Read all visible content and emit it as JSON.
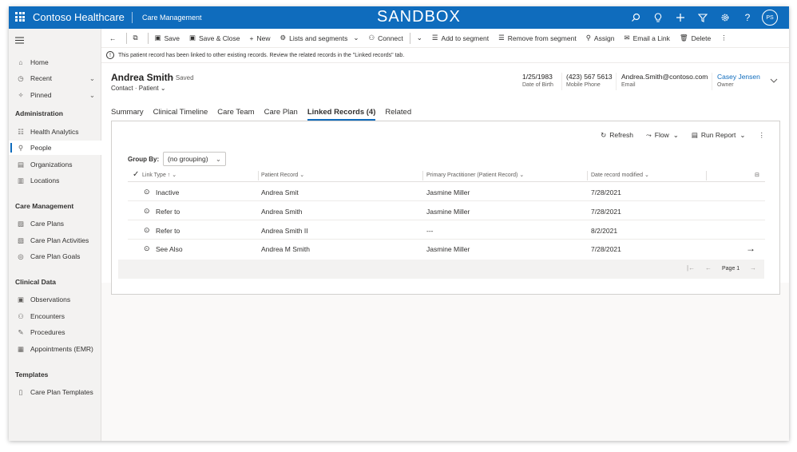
{
  "topbar": {
    "app_name": "Contoso Healthcare",
    "area": "Care Management",
    "environment": "SANDBOX",
    "icons": [
      "search-icon",
      "lightbulb-icon",
      "plus-icon",
      "filter-icon",
      "gear-icon",
      "help-icon"
    ],
    "avatar_initials": "PS"
  },
  "sidebar": {
    "top_items": [
      {
        "label": "Home",
        "icon": "home-icon"
      },
      {
        "label": "Recent",
        "icon": "clock-icon",
        "expandable": true
      },
      {
        "label": "Pinned",
        "icon": "pin-icon",
        "expandable": true
      }
    ],
    "groups": [
      {
        "title": "Administration",
        "items": [
          {
            "label": "Health Analytics",
            "icon": "analytics-icon"
          },
          {
            "label": "People",
            "icon": "person-icon",
            "active": true
          },
          {
            "label": "Organizations",
            "icon": "building-icon"
          },
          {
            "label": "Locations",
            "icon": "location-icon"
          }
        ]
      },
      {
        "title": "Care Management",
        "items": [
          {
            "label": "Care Plans",
            "icon": "care-plan-icon"
          },
          {
            "label": "Care Plan Activities",
            "icon": "activities-icon"
          },
          {
            "label": "Care Plan Goals",
            "icon": "goal-icon"
          }
        ]
      },
      {
        "title": "Clinical Data",
        "items": [
          {
            "label": "Observations",
            "icon": "observations-icon"
          },
          {
            "label": "Encounters",
            "icon": "encounters-icon"
          },
          {
            "label": "Procedures",
            "icon": "procedures-icon"
          },
          {
            "label": "Appointments (EMR)",
            "icon": "calendar-icon"
          }
        ]
      },
      {
        "title": "Templates",
        "items": [
          {
            "label": "Care Plan Templates",
            "icon": "template-icon"
          }
        ]
      }
    ]
  },
  "commandbar": {
    "save": "Save",
    "save_close": "Save & Close",
    "new": "New",
    "lists_segments": "Lists and segments",
    "connect": "Connect",
    "add_segment": "Add to segment",
    "remove_segment": "Remove from segment",
    "assign": "Assign",
    "email_link": "Email a Link",
    "delete": "Delete"
  },
  "notice": {
    "text": "This patient record has been linked to other existing records. Review the related records in the \"Linked records\" tab."
  },
  "record": {
    "name": "Andrea Smith",
    "status": "- Saved",
    "entity": "Contact",
    "form": "Patient",
    "fields": [
      {
        "value": "1/25/1983",
        "label": "Date of Birth"
      },
      {
        "value": "(423) 567 5613",
        "label": "Mobile Phone"
      },
      {
        "value": "Andrea.Smith@contoso.com",
        "label": "Email"
      },
      {
        "value": "Casey Jensen",
        "label": "Owner"
      }
    ]
  },
  "tabs": [
    "Summary",
    "Clinical Timeline",
    "Care Team",
    "Care Plan",
    "Linked Records (4)",
    "Related"
  ],
  "active_tab": "Linked Records (4)",
  "grid": {
    "commands": {
      "refresh": "Refresh",
      "flow": "Flow",
      "run_report": "Run Report"
    },
    "group_by_label": "Group By:",
    "group_by_value": "(no grouping)",
    "columns": [
      "Link Type",
      "Patient Record",
      "Primary Practitioner (Patient Record)",
      "Date record modified"
    ],
    "rows": [
      {
        "link_type": "Inactive",
        "patient": "Andrea Smit",
        "practitioner": "Jasmine Miller",
        "date": "7/28/2021"
      },
      {
        "link_type": "Refer to",
        "patient": "Andrea Smith",
        "practitioner": "Jasmine Miller",
        "date": "7/28/2021"
      },
      {
        "link_type": "Refer to",
        "patient": "Andrea Smith II",
        "practitioner": "---",
        "date": "8/2/2021"
      },
      {
        "link_type": "See Also",
        "patient": "Andrea M Smith",
        "practitioner": "Jasmine Miller",
        "date": "7/28/2021"
      }
    ],
    "page_label": "Page 1"
  }
}
